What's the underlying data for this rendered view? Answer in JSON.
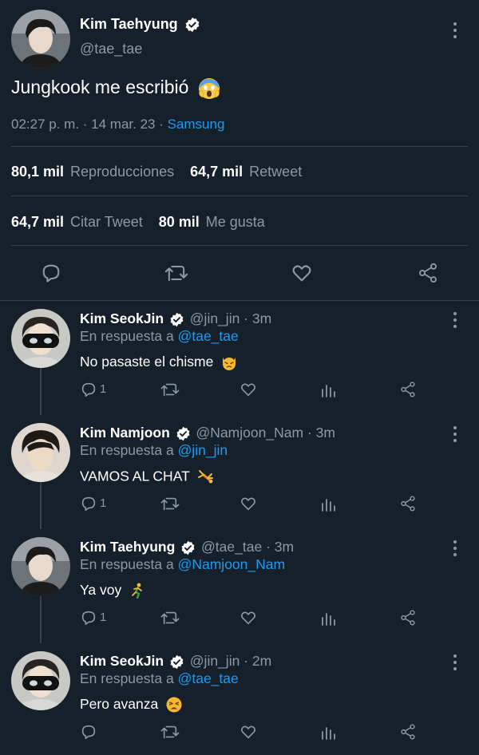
{
  "main": {
    "name": "Kim Taehyung",
    "handle": "@tae_tae",
    "text": "Jungkook me escribió",
    "time": "02:27 p. m. · 14 mar. 23 · ",
    "source": "Samsung",
    "stats": {
      "views_num": "80,1 mil",
      "views_label": "Reproducciones",
      "retweets_num": "64,7 mil",
      "retweets_label": "Retweet",
      "quotes_num": "64,7 mil",
      "quotes_label": "Citar Tweet",
      "likes_num": "80 mil",
      "likes_label": "Me gusta"
    }
  },
  "replies": [
    {
      "name": "Kim SeokJin",
      "handle": "@jin_jin",
      "time": "· 3m",
      "reply_prefix": "En respuesta a",
      "reply_to": "@tae_tae",
      "text": "No pasaste el chisme",
      "reply_count": "1"
    },
    {
      "name": "Kim Namjoon",
      "handle": "@Namjoon_Nam",
      "time": "· 3m",
      "reply_prefix": "En respuesta a",
      "reply_to": "@jin_jin",
      "text": "VAMOS AL CHAT",
      "reply_count": "1"
    },
    {
      "name": "Kim Taehyung",
      "handle": "@tae_tae",
      "time": "· 3m",
      "reply_prefix": "En respuesta a",
      "reply_to": "@Namjoon_Nam",
      "text": "Ya voy",
      "reply_count": "1"
    },
    {
      "name": "Kim SeokJin",
      "handle": "@jin_jin",
      "time": "· 2m",
      "reply_prefix": "En respuesta a",
      "reply_to": "@tae_tae",
      "text": "Pero avanza",
      "reply_count": ""
    }
  ],
  "colors": {
    "background": "#15202b",
    "accent": "#1d9bf0",
    "muted": "#8b98a5",
    "divider": "#38444d"
  },
  "icons": [
    "verified-badge-icon",
    "more-options-icon",
    "reply-icon",
    "retweet-icon",
    "like-icon",
    "share-icon",
    "analytics-icon"
  ]
}
